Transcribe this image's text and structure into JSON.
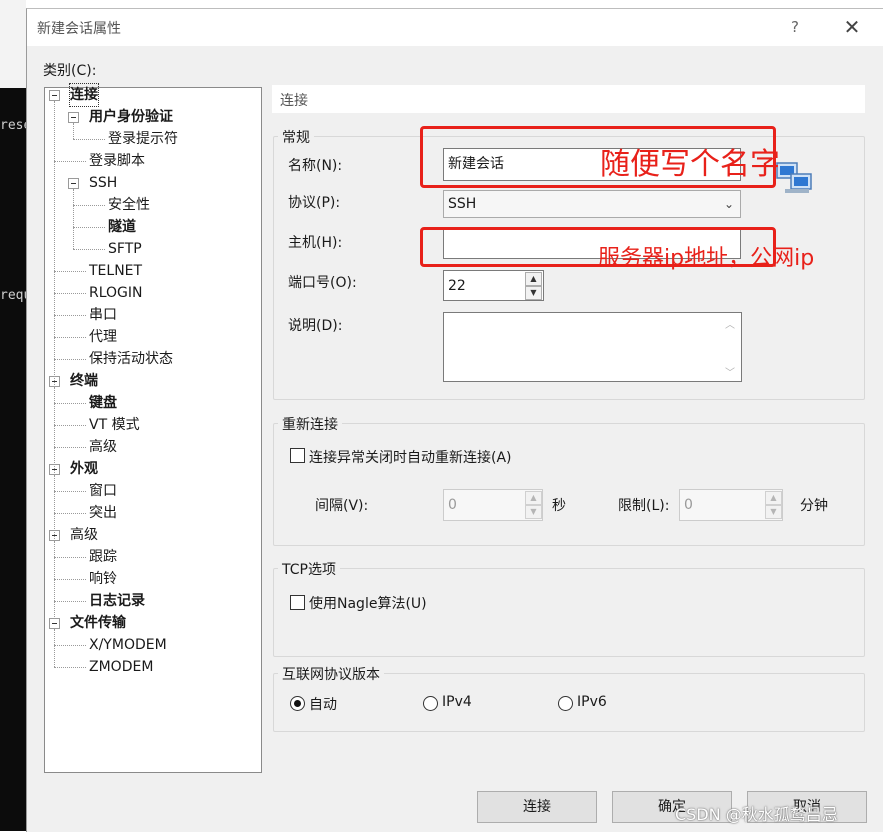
{
  "background": {
    "terminal_lines": [
      "rese",
      "requ"
    ]
  },
  "dialog": {
    "title": "新建会话属性",
    "help_glyph": "?",
    "close_glyph": "✕",
    "category_label": "类别(C):"
  },
  "tree": {
    "items": [
      {
        "label": "连接",
        "level": 0,
        "bold": true,
        "expanded": true,
        "selected": true
      },
      {
        "label": "用户身份验证",
        "level": 1,
        "bold": true,
        "expanded": true
      },
      {
        "label": "登录提示符",
        "level": 2
      },
      {
        "label": "登录脚本",
        "level": 1
      },
      {
        "label": "SSH",
        "level": 1,
        "expanded": true
      },
      {
        "label": "安全性",
        "level": 2
      },
      {
        "label": "隧道",
        "level": 2,
        "bold": true
      },
      {
        "label": "SFTP",
        "level": 2
      },
      {
        "label": "TELNET",
        "level": 1
      },
      {
        "label": "RLOGIN",
        "level": 1
      },
      {
        "label": "串口",
        "level": 1
      },
      {
        "label": "代理",
        "level": 1
      },
      {
        "label": "保持活动状态",
        "level": 1
      },
      {
        "label": "终端",
        "level": 0,
        "bold": true,
        "expanded": true
      },
      {
        "label": "键盘",
        "level": 1,
        "bold": true
      },
      {
        "label": "VT 模式",
        "level": 1
      },
      {
        "label": "高级",
        "level": 1
      },
      {
        "label": "外观",
        "level": 0,
        "bold": true,
        "expanded": true
      },
      {
        "label": "窗口",
        "level": 1
      },
      {
        "label": "突出",
        "level": 1
      },
      {
        "label": "高级",
        "level": 0,
        "expanded": true
      },
      {
        "label": "跟踪",
        "level": 1
      },
      {
        "label": "响铃",
        "level": 1
      },
      {
        "label": "日志记录",
        "level": 1,
        "bold": true
      },
      {
        "label": "文件传输",
        "level": 0,
        "bold": true,
        "expanded": true
      },
      {
        "label": "X/YMODEM",
        "level": 1
      },
      {
        "label": "ZMODEM",
        "level": 1
      }
    ]
  },
  "panel": {
    "header": "连接",
    "general": {
      "title": "常规",
      "name_label": "名称(N):",
      "name_value": "新建会话",
      "protocol_label": "协议(P):",
      "protocol_value": "SSH",
      "host_label": "主机(H):",
      "host_value": "",
      "port_label": "端口号(O):",
      "port_value": "22",
      "desc_label": "说明(D):",
      "desc_value": ""
    },
    "reconnect": {
      "title": "重新连接",
      "checkbox_label": "连接异常关闭时自动重新连接(A)",
      "checked": false,
      "interval_label": "间隔(V):",
      "interval_value": "0",
      "interval_unit": "秒",
      "limit_label": "限制(L):",
      "limit_value": "0",
      "limit_unit": "分钟"
    },
    "tcp": {
      "title": "TCP选项",
      "nagle_label": "使用Nagle算法(U)",
      "checked": false
    },
    "ip_version": {
      "title": "互联网协议版本",
      "options": [
        "自动",
        "IPv4",
        "IPv6"
      ],
      "selected": "自动"
    }
  },
  "buttons": {
    "connect": "连接",
    "ok": "确定",
    "cancel": "取消"
  },
  "annotations": {
    "name_note": "随便写个名字",
    "host_note": "服务器ip地址，公网ip",
    "color": "#e8211a"
  },
  "watermark": "CSDN @秋水孤鹜吕忌"
}
